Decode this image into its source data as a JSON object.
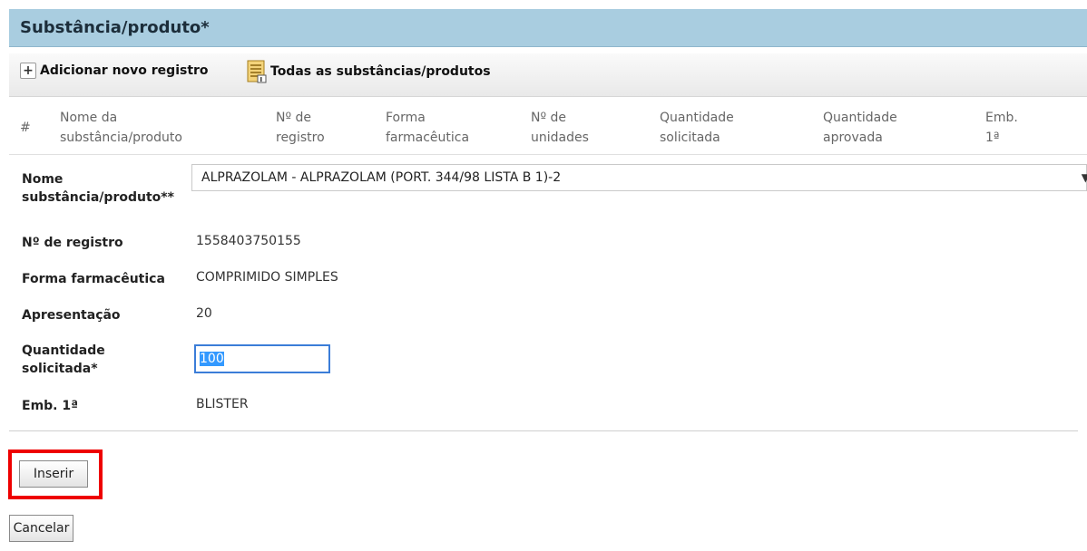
{
  "panel": {
    "title": "Substância/produto*"
  },
  "toolbar": {
    "add_label": "Adicionar novo registro",
    "all_label": "Todas as substâncias/produtos"
  },
  "grid": {
    "columns": [
      {
        "line1": "#",
        "line2": ""
      },
      {
        "line1": "Nome da",
        "line2": "substância/produto"
      },
      {
        "line1": "Nº de",
        "line2": "registro"
      },
      {
        "line1": "Forma",
        "line2": "farmacêutica"
      },
      {
        "line1": "Nº de",
        "line2": "unidades"
      },
      {
        "line1": "Quantidade",
        "line2": "solicitada"
      },
      {
        "line1": "Quantidade",
        "line2": "aprovada"
      },
      {
        "line1": "Emb.",
        "line2": "1ª"
      }
    ]
  },
  "form": {
    "nome_label_1": "Nome",
    "nome_label_2": "substância/produto**",
    "nome_value": "ALPRAZOLAM - ALPRAZOLAM (PORT. 344/98 LISTA B 1)-2",
    "registro_label": "Nº de registro",
    "registro_value": "1558403750155",
    "forma_label": "Forma farmacêutica",
    "forma_value": "COMPRIMIDO SIMPLES",
    "apresentacao_label": "Apresentação",
    "apresentacao_value": "20",
    "quantidade_label_1": "Quantidade",
    "quantidade_label_2": "solicitada*",
    "quantidade_value": "100",
    "emb_label": "Emb. 1ª",
    "emb_value": "BLISTER"
  },
  "buttons": {
    "inserir": "Inserir",
    "cancelar": "Cancelar"
  },
  "colors": {
    "header_bg": "#a9cde0",
    "highlight": "#ee0000",
    "input_focus": "#3b7dd8"
  }
}
